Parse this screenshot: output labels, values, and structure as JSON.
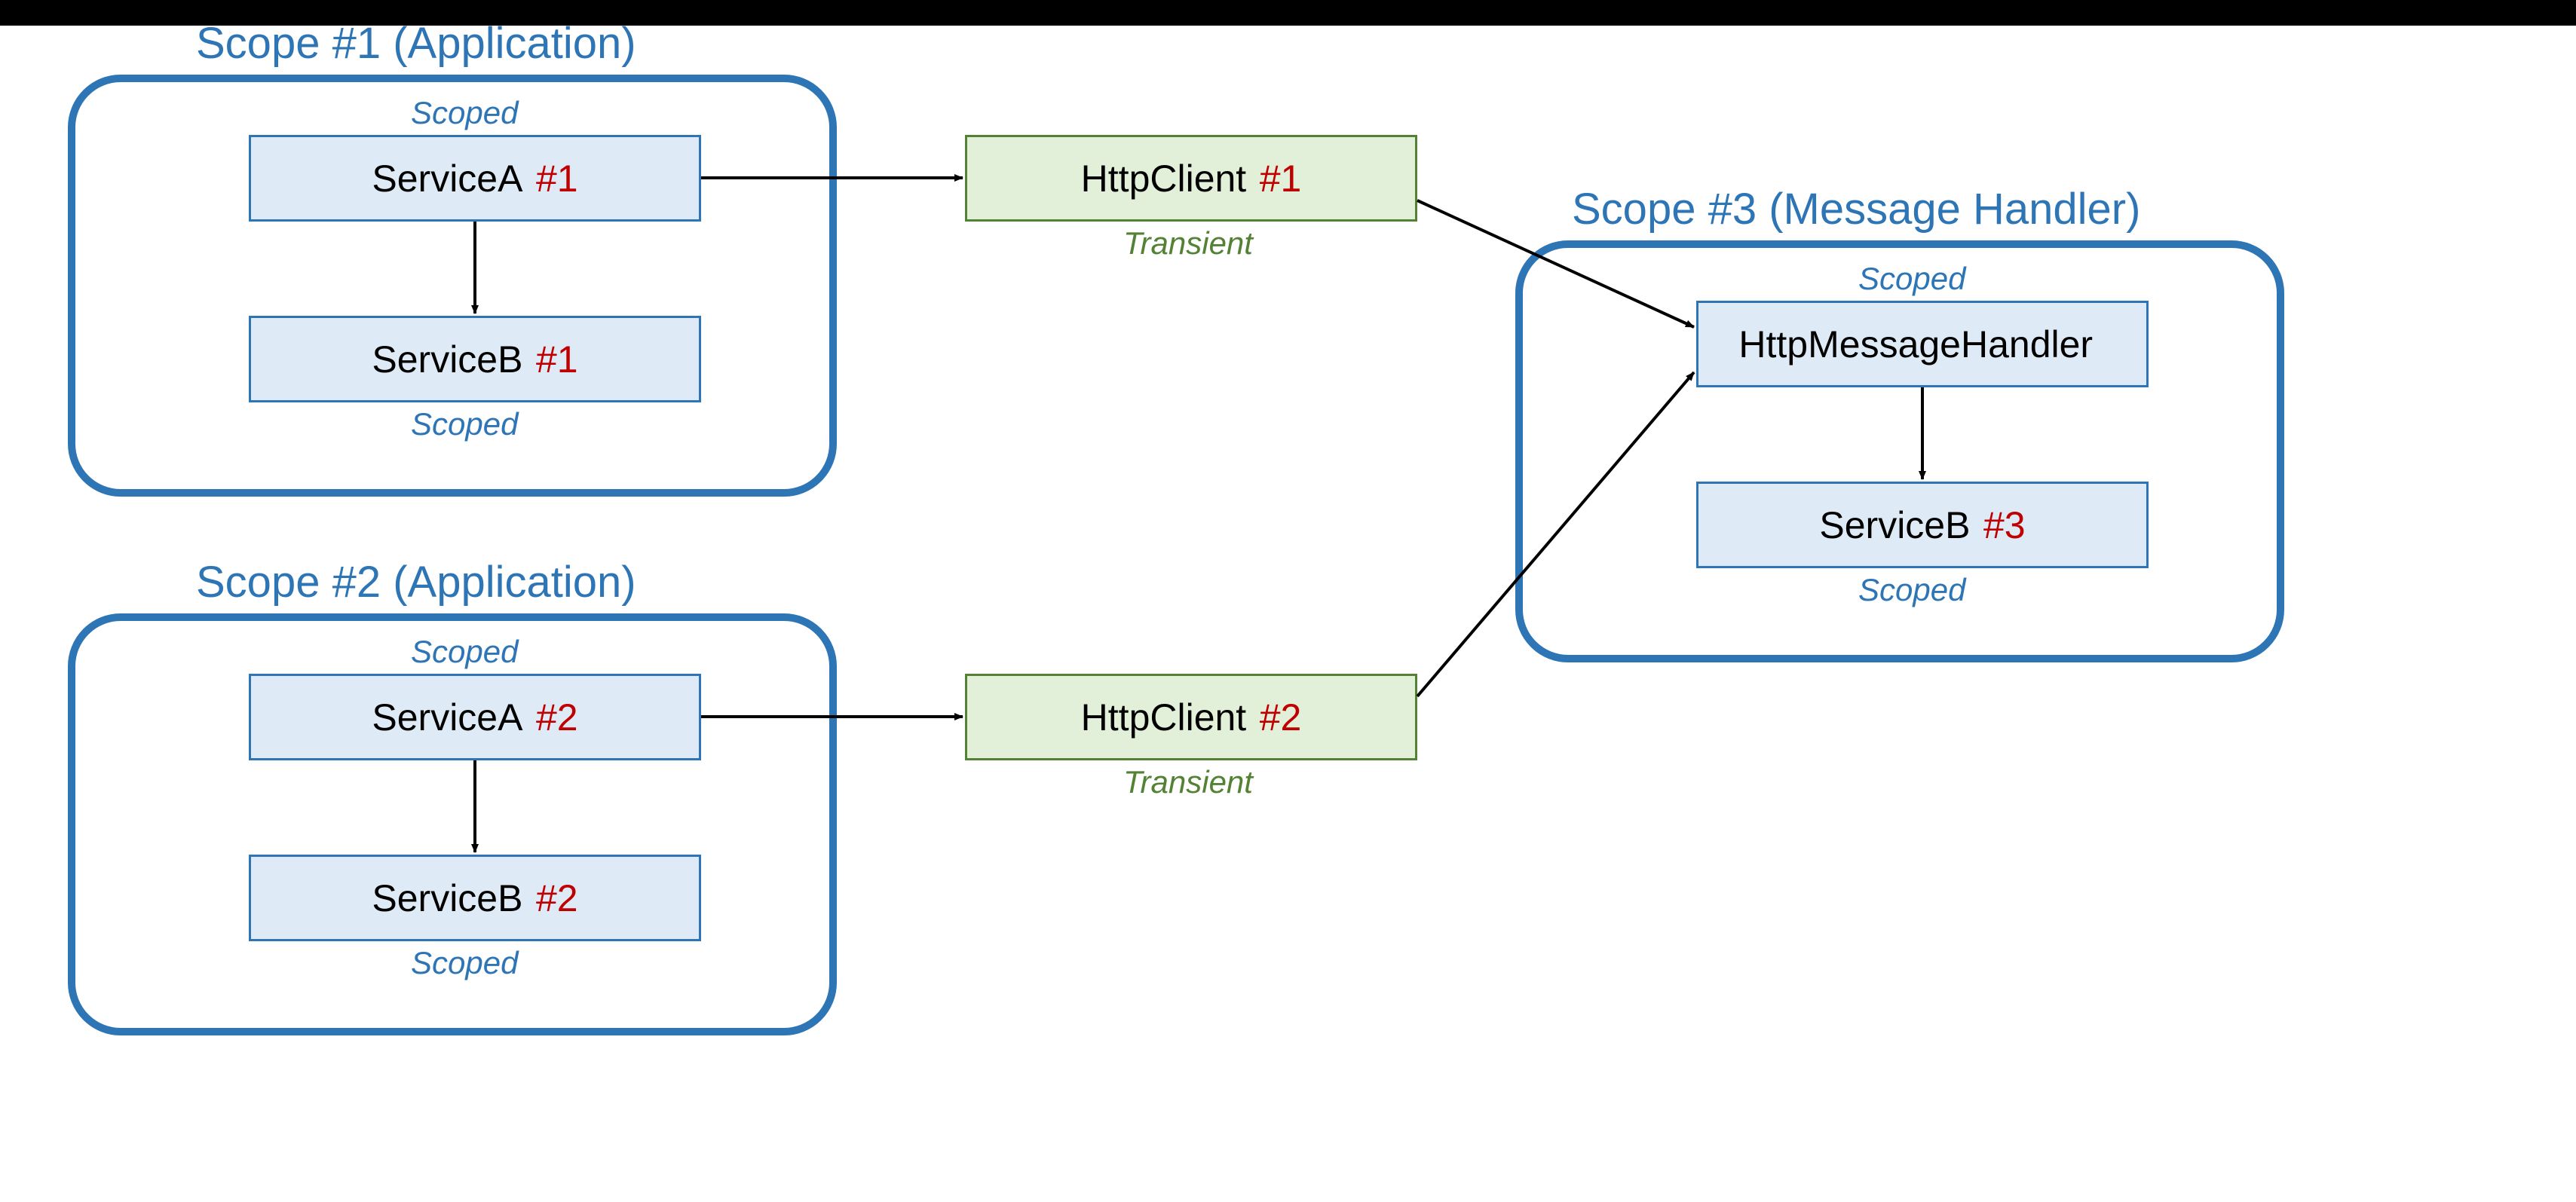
{
  "scopes": {
    "scope1": {
      "title": "Scope #1 (Application)"
    },
    "scope2": {
      "title": "Scope #2 (Application)"
    },
    "scope3": {
      "title": "Scope #3 (Message Handler)"
    }
  },
  "lifetime": {
    "scoped": "Scoped",
    "transient": "Transient"
  },
  "boxes": {
    "serviceA1": {
      "name": "ServiceA",
      "instance": "#1"
    },
    "serviceB1": {
      "name": "ServiceB",
      "instance": "#1"
    },
    "serviceA2": {
      "name": "ServiceA",
      "instance": "#2"
    },
    "serviceB2": {
      "name": "ServiceB",
      "instance": "#2"
    },
    "httpClient1": {
      "name": "HttpClient",
      "instance": "#1"
    },
    "httpClient2": {
      "name": "HttpClient",
      "instance": "#2"
    },
    "httpMessageHandler": {
      "name": "HttpMessageHandler",
      "instance": ""
    },
    "serviceB3": {
      "name": "ServiceB",
      "instance": "#3"
    }
  },
  "colors": {
    "scopeBorder": "#2e75b6",
    "serviceFill": "#deebf7",
    "serviceBorder": "#2e75b6",
    "clientFill": "#e2f0d9",
    "clientBorder": "#548235",
    "instanceText": "#c00000",
    "arrow": "#000000"
  }
}
